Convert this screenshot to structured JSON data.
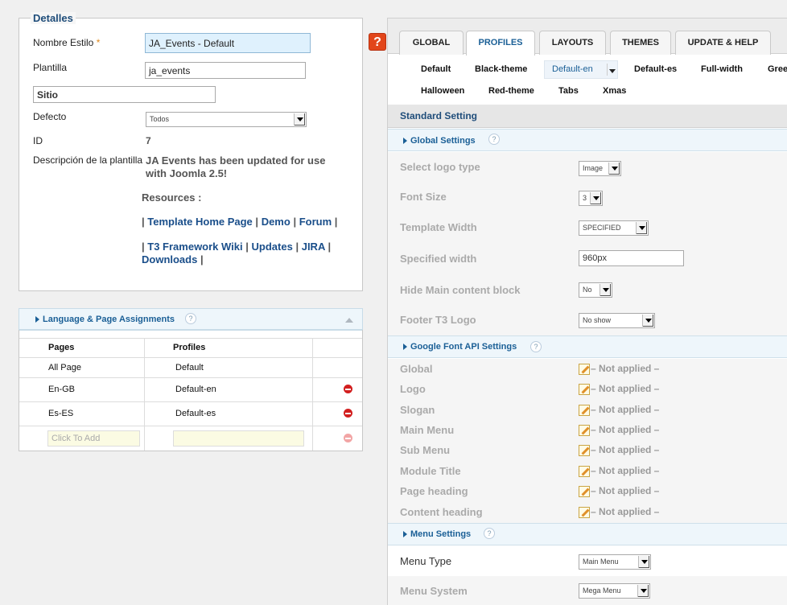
{
  "detalles": {
    "legend": "Detalles",
    "nombre_label": "Nombre Estilo",
    "required_mark": "*",
    "nombre_value": "JA_Events - Default",
    "plantilla_label": "Plantilla",
    "plantilla_value": "ja_events",
    "sitio_value": "Sitio",
    "defecto_label": "Defecto",
    "defecto_value": "Todos",
    "id_label": "ID",
    "id_value": "7",
    "desc_label": "Descripción de la plantilla",
    "desc_line1": "JA Events has been updated for use",
    "desc_line2": "with Joomla 2.5!",
    "resources": "Resources :",
    "links": [
      "Template Home Page",
      "Demo",
      "Forum",
      "T3 Framework Wiki",
      "Updates",
      "JIRA",
      "Downloads"
    ],
    "sep": "|"
  },
  "assignments": {
    "title": "Language & Page Assignments",
    "help": "?",
    "col_pages": "Pages",
    "col_profiles": "Profiles",
    "rows": [
      {
        "page": "All Page",
        "profile": "Default"
      },
      {
        "page": "En-GB",
        "profile": "Default-en"
      },
      {
        "page": "Es-ES",
        "profile": "Default-es"
      }
    ],
    "add_placeholder": "Click To Add"
  },
  "help_button": "?",
  "tabs": [
    "GLOBAL",
    "PROFILES",
    "LAYOUTS",
    "THEMES",
    "UPDATE & HELP"
  ],
  "active_tab": "PROFILES",
  "profiles": {
    "row1": [
      "Default",
      "Black-theme",
      "Default-en",
      "Default-es",
      "Full-width",
      "Gree"
    ],
    "row2": [
      "Halloween",
      "Red-theme",
      "Tabs",
      "Xmas"
    ],
    "selected": "Default-en"
  },
  "standard_setting": "Standard Setting",
  "global_settings": {
    "title": "Global Settings",
    "rows": [
      {
        "label": "Select logo type",
        "value": "Image"
      },
      {
        "label": "Font Size",
        "value": "3"
      },
      {
        "label": "Template Width",
        "value": "SPECIFIED"
      },
      {
        "label": "Specified width",
        "value": "960px"
      },
      {
        "label": "Hide Main content block",
        "value": "No"
      },
      {
        "label": "Footer T3 Logo",
        "value": "No show"
      }
    ]
  },
  "google_font": {
    "title": "Google Font API Settings",
    "not_applied": "– Not applied –",
    "rows": [
      "Global",
      "Logo",
      "Slogan",
      "Main Menu",
      "Sub Menu",
      "Module Title",
      "Page heading",
      "Content heading"
    ]
  },
  "menu_settings": {
    "title": "Menu Settings",
    "rows": [
      {
        "label": "Menu Type",
        "value": "Main Menu"
      },
      {
        "label": "Menu System",
        "value": "Mega Menu"
      }
    ]
  }
}
